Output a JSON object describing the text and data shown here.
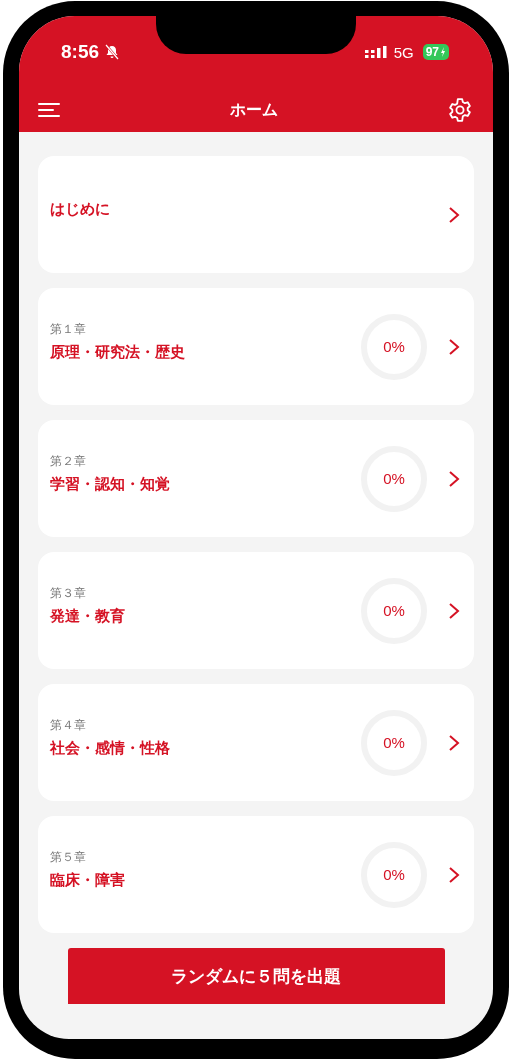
{
  "status_bar": {
    "time": "8:56",
    "network": "5G",
    "battery": "97"
  },
  "header": {
    "title": "ホーム"
  },
  "sections": [
    {
      "kind": "intro",
      "title": "はじめに"
    },
    {
      "kind": "chapter",
      "chapter": "第１章",
      "title": "原理・研究法・歴史",
      "progress": "0%"
    },
    {
      "kind": "chapter",
      "chapter": "第２章",
      "title": "学習・認知・知覚",
      "progress": "0%"
    },
    {
      "kind": "chapter",
      "chapter": "第３章",
      "title": "発達・教育",
      "progress": "0%"
    },
    {
      "kind": "chapter",
      "chapter": "第４章",
      "title": "社会・感情・性格",
      "progress": "0%"
    },
    {
      "kind": "chapter",
      "chapter": "第５章",
      "title": "臨床・障害",
      "progress": "0%"
    }
  ],
  "random_button": {
    "label": "ランダムに５問を出題"
  }
}
